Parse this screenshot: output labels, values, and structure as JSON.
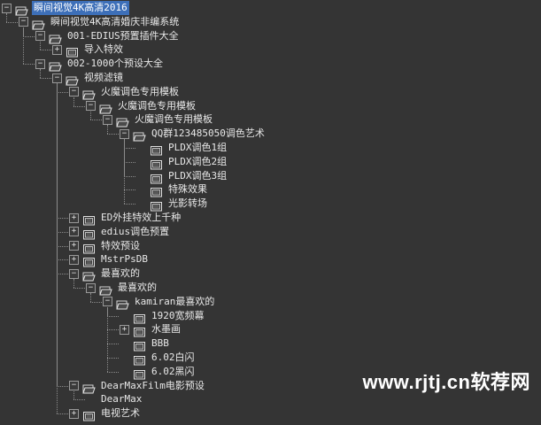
{
  "tree": [
    {
      "label": "瞬间视觉4K高清2016",
      "depth": 0,
      "toggle": "minus",
      "icon": "folder-open",
      "selected": true
    },
    {
      "label": "瞬间视觉4K高清婚庆非编系统",
      "depth": 1,
      "toggle": "minus",
      "icon": "folder-open"
    },
    {
      "label": "001-EDIUS预置插件大全",
      "depth": 2,
      "toggle": "minus",
      "icon": "folder-open"
    },
    {
      "label": "导入特效",
      "depth": 3,
      "toggle": "plus",
      "icon": "preset"
    },
    {
      "label": "002-1000个预设大全",
      "depth": 2,
      "toggle": "minus",
      "icon": "folder-open"
    },
    {
      "label": "视频滤镜",
      "depth": 3,
      "toggle": "minus",
      "icon": "folder-open"
    },
    {
      "label": "火魔调色专用模板",
      "depth": 4,
      "toggle": "minus",
      "icon": "folder-open"
    },
    {
      "label": "火魔调色专用模板",
      "depth": 5,
      "toggle": "minus",
      "icon": "folder-open"
    },
    {
      "label": "火魔调色专用模板",
      "depth": 6,
      "toggle": "minus",
      "icon": "folder-open"
    },
    {
      "label": "QQ群123485050调色艺术",
      "depth": 7,
      "toggle": "minus",
      "icon": "folder-open"
    },
    {
      "label": "PLDX调色1组",
      "depth": 8,
      "toggle": "none",
      "icon": "preset"
    },
    {
      "label": "PLDX调色2组",
      "depth": 8,
      "toggle": "none",
      "icon": "preset"
    },
    {
      "label": "PLDX调色3组",
      "depth": 8,
      "toggle": "none",
      "icon": "preset"
    },
    {
      "label": "特殊效果",
      "depth": 8,
      "toggle": "none",
      "icon": "preset"
    },
    {
      "label": "光影转场",
      "depth": 8,
      "toggle": "none",
      "icon": "preset"
    },
    {
      "label": "ED外挂特效上千种",
      "depth": 4,
      "toggle": "plus",
      "icon": "preset"
    },
    {
      "label": "edius调色预置",
      "depth": 4,
      "toggle": "plus",
      "icon": "preset"
    },
    {
      "label": "特效预设",
      "depth": 4,
      "toggle": "plus",
      "icon": "preset"
    },
    {
      "label": "MstrPsDB",
      "depth": 4,
      "toggle": "plus",
      "icon": "preset"
    },
    {
      "label": "最喜欢的",
      "depth": 4,
      "toggle": "minus",
      "icon": "folder-open"
    },
    {
      "label": "最喜欢的",
      "depth": 5,
      "toggle": "minus",
      "icon": "folder-open"
    },
    {
      "label": "kamiran最喜欢的",
      "depth": 6,
      "toggle": "minus",
      "icon": "folder-open"
    },
    {
      "label": "1920宽频幕",
      "depth": 7,
      "toggle": "none",
      "icon": "preset"
    },
    {
      "label": "水墨画",
      "depth": 7,
      "toggle": "plus",
      "icon": "preset"
    },
    {
      "label": "BBB",
      "depth": 7,
      "toggle": "none",
      "icon": "preset"
    },
    {
      "label": "6.02白闪",
      "depth": 7,
      "toggle": "none",
      "icon": "preset"
    },
    {
      "label": "6.02黑闪",
      "depth": 7,
      "toggle": "none",
      "icon": "preset"
    },
    {
      "label": "DearMaxFilm电影预设",
      "depth": 4,
      "toggle": "minus",
      "icon": "folder-open"
    },
    {
      "label": "DearMax",
      "depth": 5,
      "toggle": "none",
      "icon": "none"
    },
    {
      "label": "电视艺术",
      "depth": 4,
      "toggle": "plus",
      "icon": "preset"
    }
  ],
  "watermark": "www.rjtj.cn软荐网"
}
